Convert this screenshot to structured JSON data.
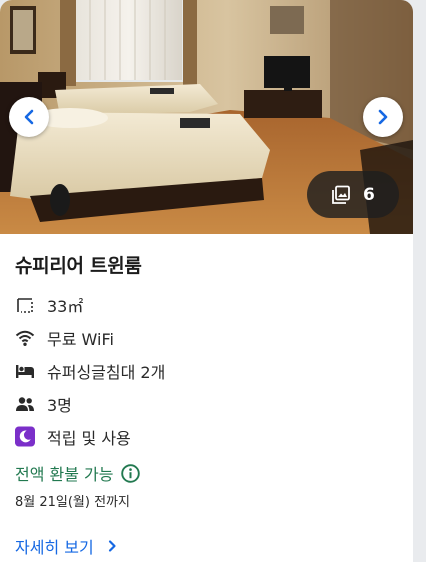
{
  "gallery": {
    "photo_count": "6"
  },
  "room": {
    "title": "슈피리어 트윈룸",
    "features": [
      {
        "icon": "room-size-icon",
        "text": "33㎡"
      },
      {
        "icon": "wifi-icon",
        "text": "무료 WiFi"
      },
      {
        "icon": "bed-icon",
        "text": "슈퍼싱글침대 2개"
      },
      {
        "icon": "people-icon",
        "text": "3명"
      },
      {
        "icon": "reward-moon-icon",
        "text": "적립 및 사용"
      }
    ]
  },
  "refund": {
    "label": "전액 환불 가능",
    "deadline": "8월 21일(월) 전까지"
  },
  "link": {
    "label": "자세히 보기"
  },
  "colors": {
    "refund_green": "#227950",
    "link_blue": "#1668e3",
    "reward_purple": "#7b2fc9"
  }
}
